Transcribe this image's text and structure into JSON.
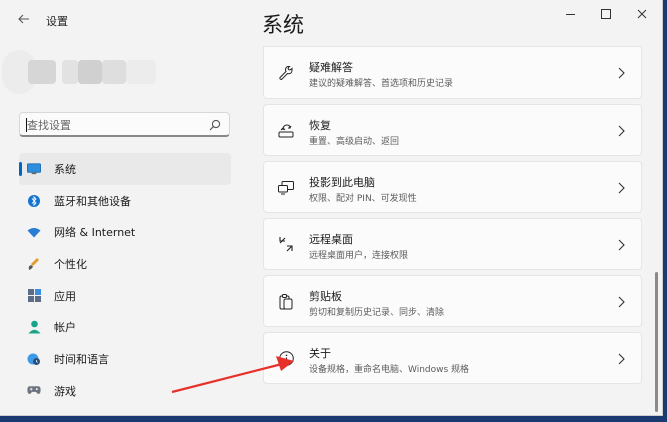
{
  "window": {
    "app_title": "设置",
    "page_title": "系统"
  },
  "search": {
    "placeholder": "查找设置"
  },
  "sidebar": {
    "items": [
      {
        "label": "系统",
        "icon": "monitor-icon",
        "active": true
      },
      {
        "label": "蓝牙和其他设备",
        "icon": "bluetooth-icon"
      },
      {
        "label": "网络 & Internet",
        "icon": "wifi-icon"
      },
      {
        "label": "个性化",
        "icon": "brush-icon"
      },
      {
        "label": "应用",
        "icon": "apps-icon"
      },
      {
        "label": "帐户",
        "icon": "person-icon"
      },
      {
        "label": "时间和语言",
        "icon": "globe-clock-icon"
      },
      {
        "label": "游戏",
        "icon": "gamepad-icon"
      }
    ]
  },
  "cards": [
    {
      "title": "疑难解答",
      "desc": "建议的疑难解答、首选项和历史记录",
      "icon": "wrench-icon"
    },
    {
      "title": "恢复",
      "desc": "重置、高级启动、返回",
      "icon": "recovery-icon"
    },
    {
      "title": "投影到此电脑",
      "desc": "权限、配对 PIN、可发现性",
      "icon": "project-icon"
    },
    {
      "title": "远程桌面",
      "desc": "远程桌面用户，连接权限",
      "icon": "remote-desktop-icon"
    },
    {
      "title": "剪贴板",
      "desc": "剪切和复制历史记录、同步、清除",
      "icon": "clipboard-icon"
    },
    {
      "title": "关于",
      "desc": "设备规格，重命名电脑、Windows 规格",
      "icon": "info-icon"
    }
  ],
  "colors": {
    "accent": "#0067c0",
    "annotation_arrow": "#e8302a"
  }
}
